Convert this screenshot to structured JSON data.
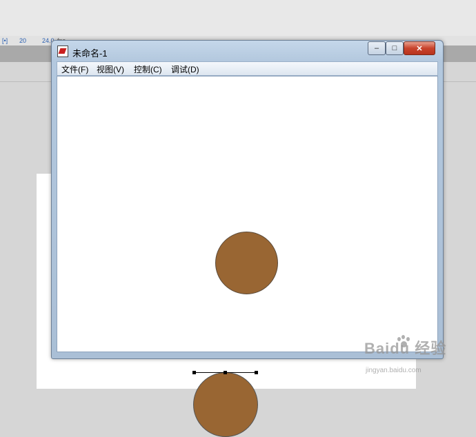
{
  "background_toolbar": {
    "items": [
      "[•]",
      "20",
      "24.0",
      "fps"
    ]
  },
  "window": {
    "title": "未命名-1",
    "buttons": {
      "minimize": "–",
      "maximize": "□",
      "close": "✕"
    },
    "menu": [
      "文件(F)",
      "视图(V)",
      "控制(C)",
      "调试(D)"
    ]
  },
  "stage": {
    "ball_color": "#996633"
  },
  "watermark": {
    "brand": "Baidu 经验",
    "url": "jingyan.baidu.com"
  }
}
